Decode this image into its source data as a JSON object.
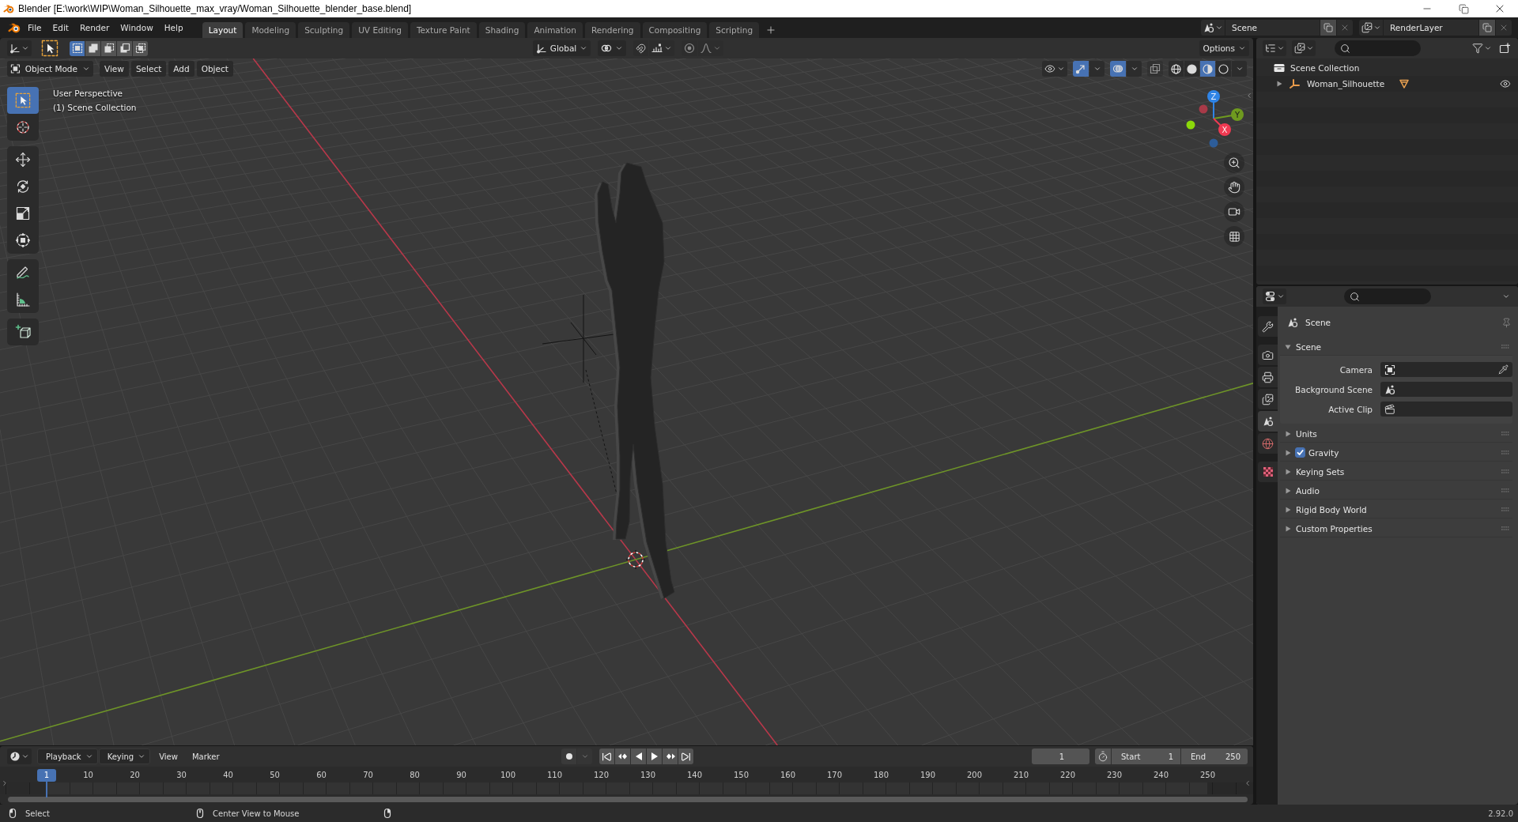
{
  "window": {
    "title": "Blender [E:\\work\\WIP\\Woman_Silhouette_max_vray/Woman_Silhouette_blender_base.blend]"
  },
  "menu": [
    "File",
    "Edit",
    "Render",
    "Window",
    "Help"
  ],
  "workspaces": [
    {
      "label": "Layout",
      "selected": true
    },
    {
      "label": "Modeling",
      "selected": false
    },
    {
      "label": "Sculpting",
      "selected": false
    },
    {
      "label": "UV Editing",
      "selected": false
    },
    {
      "label": "Texture Paint",
      "selected": false
    },
    {
      "label": "Shading",
      "selected": false
    },
    {
      "label": "Animation",
      "selected": false
    },
    {
      "label": "Rendering",
      "selected": false
    },
    {
      "label": "Compositing",
      "selected": false
    },
    {
      "label": "Scripting",
      "selected": false
    }
  ],
  "scene": {
    "value": "Scene"
  },
  "view_layer": {
    "value": "RenderLayer"
  },
  "tool_header": {
    "select_modes": [
      {
        "kind": "set",
        "selected": true
      },
      {
        "kind": "extend",
        "selected": false
      },
      {
        "kind": "subtract",
        "selected": false
      },
      {
        "kind": "invert",
        "selected": false
      },
      {
        "kind": "intersect",
        "selected": false
      }
    ],
    "orientation": "Global",
    "snap": {
      "on": false
    },
    "proportional": {
      "on": false
    },
    "options": "Options"
  },
  "viewport": {
    "mode": "Object Mode",
    "menus": [
      "View",
      "Select",
      "Add",
      "Object"
    ],
    "gizmos": {
      "on": true
    },
    "overlays": {
      "on": true
    },
    "xray": {
      "on": false
    },
    "shading": [
      {
        "kind": "wireframe",
        "selected": false
      },
      {
        "kind": "solid",
        "selected": false
      },
      {
        "kind": "material",
        "selected": true
      },
      {
        "kind": "rendered",
        "selected": false
      }
    ],
    "tool_groups": [
      {
        "tools": [
          {
            "kind": "select_box",
            "selected": true
          },
          {
            "kind": "cursor",
            "selected": false
          }
        ]
      },
      {
        "tools": [
          {
            "kind": "move",
            "selected": false
          },
          {
            "kind": "rotate",
            "selected": false
          },
          {
            "kind": "scale",
            "selected": false
          },
          {
            "kind": "transform",
            "selected": false
          }
        ]
      },
      {
        "tools": [
          {
            "kind": "annotate",
            "selected": false
          },
          {
            "kind": "measure",
            "selected": false
          }
        ]
      },
      {
        "tools": [
          {
            "kind": "add_cube",
            "selected": false
          }
        ]
      }
    ],
    "info": [
      "User Perspective",
      "(1) Scene Collection"
    ],
    "gizmo_axes": [
      {
        "kind": "z",
        "label": "Z"
      },
      {
        "kind": "y",
        "label": "Y"
      },
      {
        "kind": "x",
        "label": "X"
      }
    ]
  },
  "outliner": {
    "tree": [
      {
        "kind": "collection",
        "label": "Scene Collection",
        "children": [
          {
            "kind": "object",
            "label": "Woman_Silhouette",
            "expanded": false,
            "visible": true
          }
        ]
      }
    ]
  },
  "properties": {
    "tab_groups": [
      {
        "tabs": [
          {
            "kind": "tool",
            "selected": false
          }
        ]
      },
      {
        "tabs": [
          {
            "kind": "render",
            "selected": false
          },
          {
            "kind": "output",
            "selected": false
          },
          {
            "kind": "view_layer",
            "selected": false
          },
          {
            "kind": "scene",
            "selected": true
          },
          {
            "kind": "world",
            "selected": false
          }
        ]
      },
      {
        "tabs": [
          {
            "kind": "texture",
            "selected": false
          }
        ]
      }
    ],
    "context": "Scene",
    "panels": [
      {
        "label": "Scene",
        "expanded": true,
        "fields": [
          {
            "label": "Camera",
            "kind": "camera"
          },
          {
            "label": "Background Scene",
            "kind": "scene"
          },
          {
            "label": "Active Clip",
            "kind": "clip"
          }
        ]
      },
      {
        "label": "Units",
        "expanded": false
      },
      {
        "label": "Gravity",
        "expanded": false,
        "toggle": {
          "checked": true
        }
      },
      {
        "label": "Keying Sets",
        "expanded": false
      },
      {
        "label": "Audio",
        "expanded": false
      },
      {
        "label": "Rigid Body World",
        "expanded": false
      },
      {
        "label": "Custom Properties",
        "expanded": false
      }
    ]
  },
  "timeline": {
    "menus": [
      {
        "label": "Playback",
        "kind": "dropdown"
      },
      {
        "label": "Keying",
        "kind": "dropdown"
      },
      {
        "label": "View",
        "kind": "menu"
      },
      {
        "label": "Marker",
        "kind": "menu"
      }
    ],
    "current_frame": "1",
    "start": {
      "label": "Start",
      "value": "1"
    },
    "end": {
      "label": "End",
      "value": "250"
    },
    "playhead": "1",
    "ruler": [
      "10",
      "20",
      "30",
      "40",
      "50",
      "60",
      "70",
      "80",
      "90",
      "100",
      "110",
      "120",
      "130",
      "140",
      "150",
      "160",
      "170",
      "180",
      "190",
      "200",
      "210",
      "220",
      "230",
      "240",
      "250"
    ]
  },
  "status_bar": {
    "hints": [
      {
        "kind": "left_click",
        "label": "Select"
      },
      {
        "kind": "middle_click",
        "label": "Center View to Mouse"
      },
      {
        "kind": "right_click"
      }
    ],
    "version": "2.92.0"
  }
}
